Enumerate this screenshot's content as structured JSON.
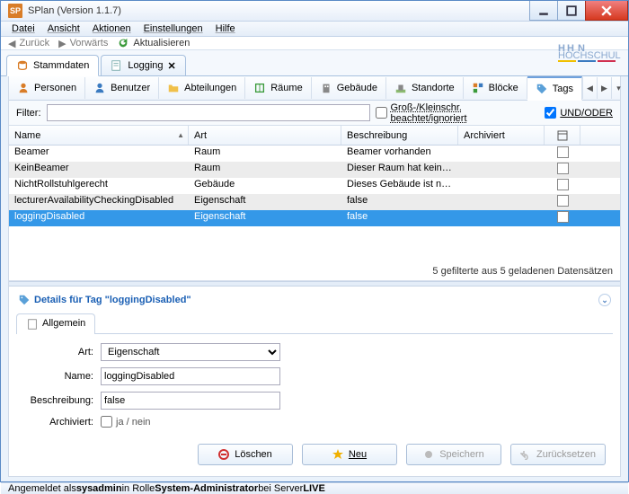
{
  "window": {
    "title": "SPlan (Version 1.1.7)",
    "icon_text": "SP"
  },
  "menu": {
    "items": [
      "Datei",
      "Ansicht",
      "Aktionen",
      "Einstellungen",
      "Hilfe"
    ]
  },
  "nav": {
    "back": "Zurück",
    "forward": "Vorwärts",
    "refresh": "Aktualisieren"
  },
  "main_tabs": {
    "stammdaten": "Stammdaten",
    "logging": "Logging"
  },
  "sub_tabs": {
    "items": [
      {
        "label": "Personen"
      },
      {
        "label": "Benutzer"
      },
      {
        "label": "Abteilungen"
      },
      {
        "label": "Räume"
      },
      {
        "label": "Gebäude"
      },
      {
        "label": "Standorte"
      },
      {
        "label": "Blöcke"
      },
      {
        "label": "Tags"
      }
    ],
    "active": 7
  },
  "filter": {
    "label": "Filter:",
    "value": "",
    "case_label": "Groß-/Kleinschr. beachtet/ignoriert",
    "case_checked": false,
    "andor_label": "UND/ODER",
    "andor_checked": true
  },
  "grid": {
    "columns": {
      "name": "Name",
      "art": "Art",
      "beschreibung": "Beschreibung",
      "archiviert": "Archiviert"
    },
    "rows": [
      {
        "name": "Beamer",
        "art": "Raum",
        "beschreibung": "Beamer vorhanden",
        "archiviert": false
      },
      {
        "name": "KeinBeamer",
        "art": "Raum",
        "beschreibung": "Dieser Raum hat keinen Beamer",
        "archiviert": false
      },
      {
        "name": "NichtRollstuhlgerecht",
        "art": "Gebäude",
        "beschreibung": "Dieses Gebäude ist nicht rollst...",
        "archiviert": false
      },
      {
        "name": "lecturerAvailabilityCheckingDisabled",
        "art": "Eigenschaft",
        "beschreibung": "false",
        "archiviert": false
      },
      {
        "name": "loggingDisabled",
        "art": "Eigenschaft",
        "beschreibung": "false",
        "archiviert": false,
        "selected": true
      }
    ],
    "footer": "5 gefilterte aus 5 geladenen Datensätzen"
  },
  "details": {
    "header_prefix": "Details für Tag \"",
    "header_value": "loggingDisabled",
    "header_suffix": "\"",
    "tab": "Allgemein",
    "labels": {
      "art": "Art:",
      "name": "Name:",
      "beschreibung": "Beschreibung:",
      "archiviert": "Archiviert:"
    },
    "values": {
      "art": "Eigenschaft",
      "name": "loggingDisabled",
      "beschreibung": "false",
      "archiviert": false
    },
    "janein": "ja / nein"
  },
  "buttons": {
    "delete": "Löschen",
    "new": "Neu",
    "save": "Speichern",
    "reset": "Zurücksetzen"
  },
  "status": {
    "prefix": "Angemeldet als ",
    "user": "sysadmin",
    "mid": " in Rolle ",
    "role": "System-Administrator",
    "mid2": " bei Server ",
    "server": "LIVE"
  }
}
